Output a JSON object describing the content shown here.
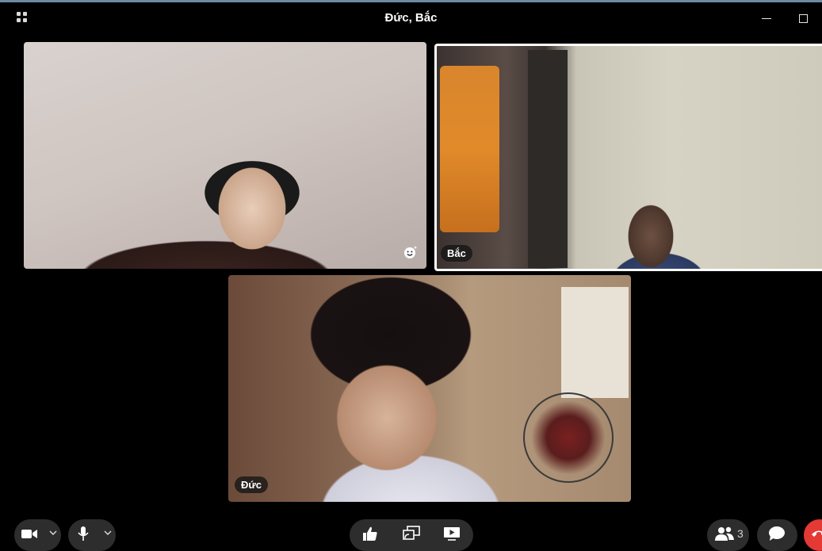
{
  "window": {
    "title": "Đức, Bắc"
  },
  "participants": {
    "self": {
      "name": "",
      "effects_icon": "smiley-sparkle-icon"
    },
    "bac": {
      "name": "Bắc",
      "active_speaker": true
    },
    "duc": {
      "name": "Đức"
    }
  },
  "controls": {
    "video": {
      "icon": "video-camera-icon",
      "menu_icon": "chevron-down-icon"
    },
    "mic": {
      "icon": "microphone-icon",
      "menu_icon": "chevron-down-icon"
    },
    "reactions": {
      "icon": "thumbs-up-icon"
    },
    "share_screen": {
      "icon": "share-screen-icon"
    },
    "present": {
      "icon": "play-screen-icon"
    },
    "people": {
      "icon": "people-icon",
      "count": "3"
    },
    "chat": {
      "icon": "chat-bubble-icon"
    },
    "end_call": {
      "icon": "end-call-icon",
      "color": "#e53935"
    }
  },
  "colors": {
    "background": "#000000",
    "active_border": "#ffffff",
    "control_bg": "#2d2d2d"
  }
}
